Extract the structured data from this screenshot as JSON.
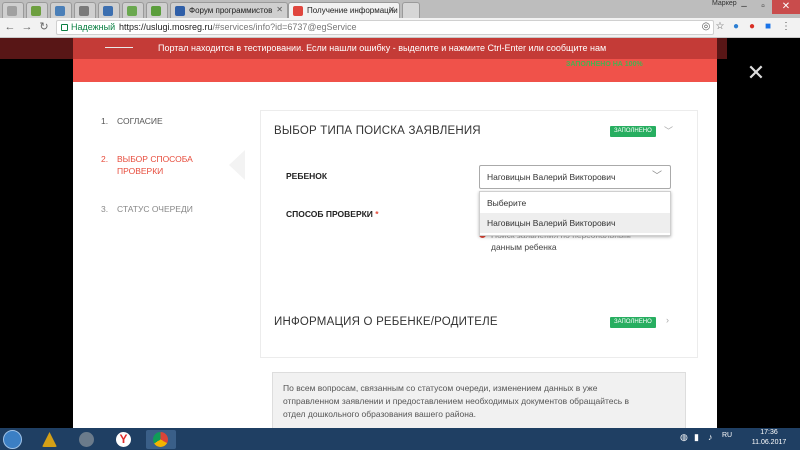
{
  "browser": {
    "tabs": [
      {
        "label": "",
        "icon": "generic-tab-icon"
      },
      {
        "label": "",
        "icon": "generic-tab-icon"
      },
      {
        "label": "",
        "icon": "generic-tab-icon"
      },
      {
        "label": "",
        "icon": "generic-tab-icon"
      },
      {
        "label": "",
        "icon": "generic-tab-icon"
      },
      {
        "label": "",
        "icon": "generic-tab-icon"
      },
      {
        "label": "",
        "icon": "generic-tab-icon"
      },
      {
        "label": "Форум программистов",
        "icon": "forum-icon"
      },
      {
        "label": "Получение информации",
        "icon": "gosuslugi-icon"
      }
    ],
    "secure_label": "Надежный",
    "url_host": "https://uslugi.mosreg.ru",
    "url_path": "/#services/info?id=6737@egService",
    "user_label": "Маркер"
  },
  "banner": {
    "text": "Портал находится в тестировании. Если нашли ошибку - выделите и нажмите Ctrl-Enter или сообщите нам",
    "progress_label": "ЗАПОЛНЕНО НА 100%"
  },
  "steps": [
    {
      "num": "1.",
      "label": "СОГЛАСИЕ",
      "active": false
    },
    {
      "num": "2.",
      "label": "ВЫБОР СПОСОБА",
      "label2": "ПРОВЕРКИ",
      "active": true
    },
    {
      "num": "3.",
      "label": "СТАТУС ОЧЕРЕДИ",
      "active": false
    }
  ],
  "section1": {
    "title": "ВЫБОР ТИПА ПОИСКА ЗАЯВЛЕНИЯ",
    "badge": "ЗАПОЛНЕНО",
    "child_label": "РЕБЕНОК",
    "child_value": "Наговицын Валерий Викторович",
    "method_label": "СПОСОБ ПРОВЕРКИ",
    "required_mark": "*",
    "dropdown_options": [
      "Выберите",
      "Наговицын Валерий Викторович"
    ],
    "radio_text_1": "Поиск заявления по персональным",
    "radio_text_2": "данным ребенка"
  },
  "section2": {
    "title": "ИНФОРМАЦИЯ О РЕБЕНКЕ/РОДИТЕЛЕ",
    "badge": "ЗАПОЛНЕНО"
  },
  "info": {
    "line1": "По всем вопросам, связанным со статусом очереди, изменением данных в уже",
    "line2": "отправленном заявлении и предоставлением необходимых документов обращайтесь в",
    "line3": "отдел дошкольного образования вашего района."
  },
  "taskbar": {
    "time": "17:36",
    "date": "11.06.2017"
  },
  "colors": {
    "accent": "#f0524a",
    "success": "#27ae60",
    "active_step": "#e74c3c"
  }
}
